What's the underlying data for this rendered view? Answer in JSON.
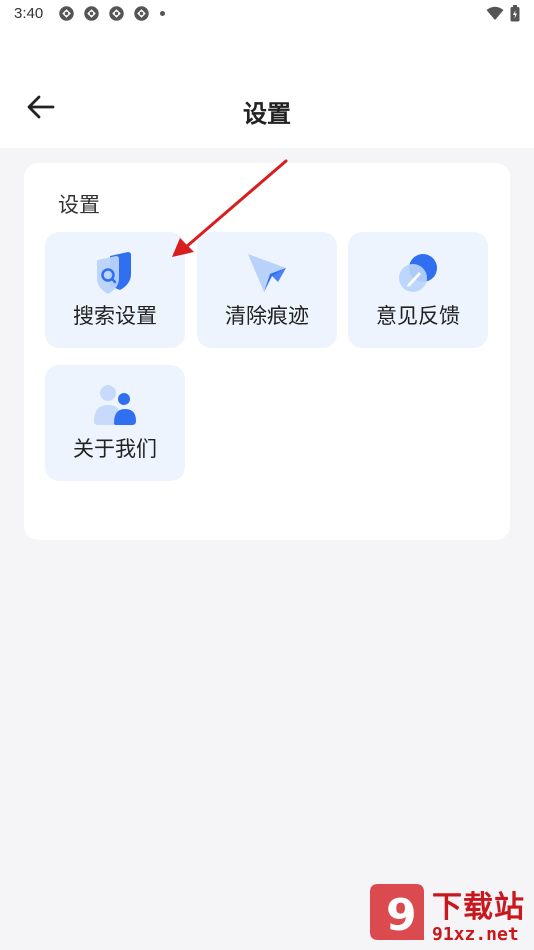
{
  "status_bar": {
    "time": "3:40",
    "notification_icons": [
      "app-notification-icon",
      "app-notification-icon",
      "app-notification-icon",
      "app-notification-icon"
    ],
    "wifi_icon": "wifi-icon",
    "battery_icon": "battery-icon"
  },
  "header": {
    "back_icon": "arrow-left-icon",
    "title": "设置"
  },
  "settings_card": {
    "title": "设置",
    "tiles": [
      {
        "label": "搜索设置",
        "icon": "search-shield-icon"
      },
      {
        "label": "清除痕迹",
        "icon": "cursor-arrow-icon"
      },
      {
        "label": "意见反馈",
        "icon": "pen-feedback-icon"
      },
      {
        "label": "关于我们",
        "icon": "users-icon"
      }
    ]
  },
  "watermark": {
    "badge": "9",
    "brand": "下载站",
    "url": "91xz.net"
  },
  "colors": {
    "tile_bg": "#eef4fd",
    "icon_blue": "#2f6ff0",
    "icon_light_blue": "#a9c8fb",
    "annotation_red": "#d81e1e",
    "watermark_red": "#c9171e"
  }
}
